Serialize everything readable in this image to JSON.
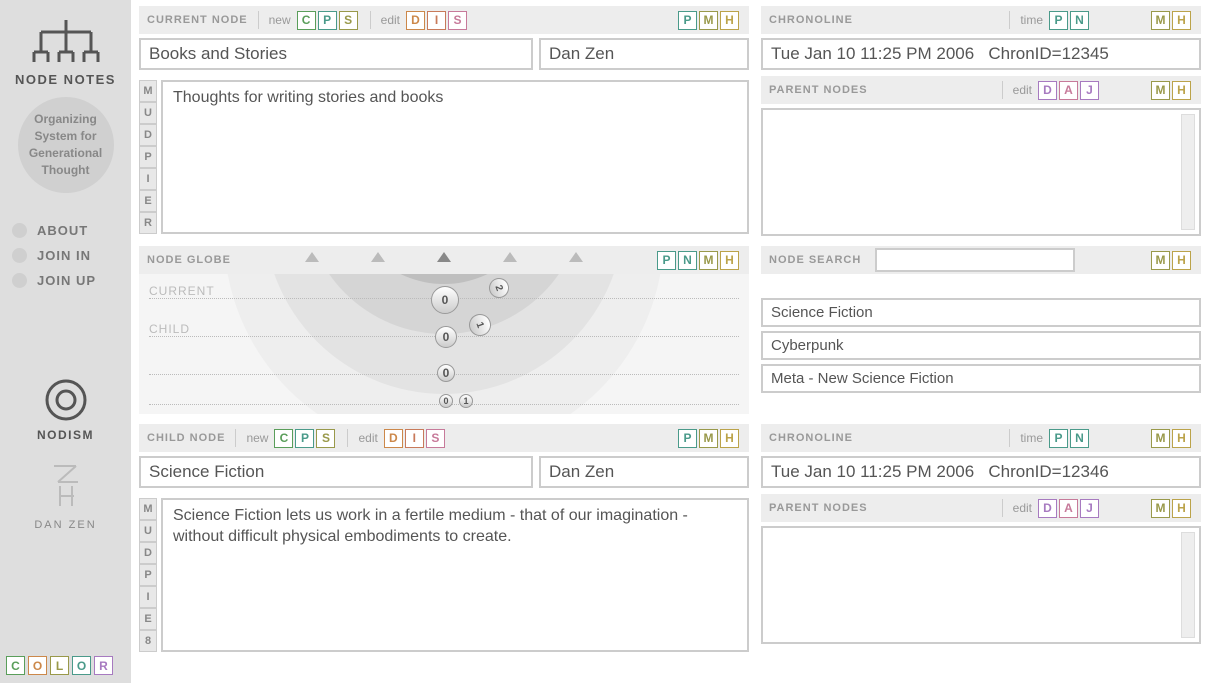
{
  "sidebar": {
    "app_title": "NODE NOTES",
    "tagline": "Organizing System for Generational Thought",
    "menu": [
      "ABOUT",
      "JOIN IN",
      "JOIN UP"
    ],
    "nodism": "NODISM",
    "danzen": "DAN ZEN",
    "color_chips": [
      "C",
      "O",
      "L",
      "O",
      "R"
    ]
  },
  "current": {
    "section": "CURRENT NODE",
    "new_label": "new",
    "edit_label": "edit",
    "new_chips": [
      "C",
      "P",
      "S"
    ],
    "edit_chips": [
      "D",
      "I",
      "S"
    ],
    "right_chips": [
      "P",
      "M",
      "H"
    ],
    "title": "Books and Stories",
    "author": "Dan Zen",
    "notes": "Thoughts for writing stories and books",
    "vstack": [
      "M",
      "U",
      "D",
      "P",
      "I",
      "E",
      "R"
    ]
  },
  "chrono1": {
    "section": "CHRONOLINE",
    "time_label": "time",
    "time_chips": [
      "P",
      "N"
    ],
    "right_chips": [
      "M",
      "H"
    ],
    "value": "Tue Jan 10 11:25 PM 2006   ChronID=12345"
  },
  "parents1": {
    "section": "PARENT NODES",
    "edit_label": "edit",
    "edit_chips": [
      "D",
      "A",
      "J"
    ],
    "right_chips": [
      "M",
      "H"
    ]
  },
  "globe": {
    "section": "NODE GLOBE",
    "chips": [
      "P",
      "N",
      "M",
      "H"
    ],
    "row1": "CURRENT",
    "row2": "CHILD"
  },
  "search": {
    "section": "NODE SEARCH",
    "right_chips": [
      "M",
      "H"
    ],
    "results": [
      "Science Fiction",
      "Cyberpunk",
      "Meta - New Science Fiction"
    ]
  },
  "child": {
    "section": "CHILD NODE",
    "new_label": "new",
    "edit_label": "edit",
    "new_chips": [
      "C",
      "P",
      "S"
    ],
    "edit_chips": [
      "D",
      "I",
      "S"
    ],
    "right_chips": [
      "P",
      "M",
      "H"
    ],
    "title": "Science Fiction",
    "author": "Dan Zen",
    "notes": "Science Fiction lets us work in a fertile medium - that of our imagination - without difficult physical embodiments to create.",
    "vstack": [
      "M",
      "U",
      "D",
      "P",
      "I",
      "E",
      "8"
    ]
  },
  "chrono2": {
    "section": "CHRONOLINE",
    "time_label": "time",
    "time_chips": [
      "P",
      "N"
    ],
    "right_chips": [
      "M",
      "H"
    ],
    "value": "Tue Jan 10 11:25 PM 2006   ChronID=12346"
  },
  "parents2": {
    "section": "PARENT NODES",
    "edit_label": "edit",
    "edit_chips": [
      "D",
      "A",
      "J"
    ],
    "right_chips": [
      "M",
      "H"
    ]
  }
}
